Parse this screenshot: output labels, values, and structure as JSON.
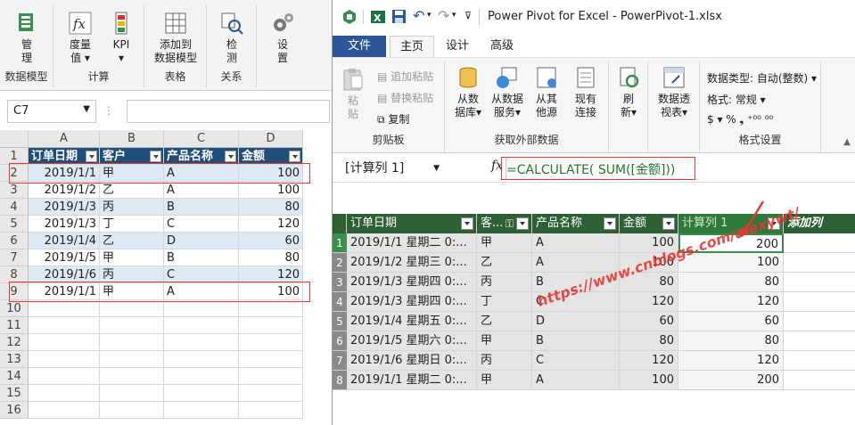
{
  "excel": {
    "ribbon_groups": [
      {
        "buttons": [
          "管",
          "理"
        ],
        "label": "数据模型"
      },
      {
        "buttons": [
          "度量",
          "值",
          "KPI"
        ],
        "label": "计算"
      },
      {
        "buttons": [
          "添加到",
          "数据模型"
        ],
        "label": "表格"
      },
      {
        "buttons": [
          "检",
          "测"
        ],
        "label": "关系"
      },
      {
        "buttons": [
          "设",
          "置"
        ],
        "label": ""
      }
    ],
    "namebox": "C7",
    "fx": "fx",
    "col_letters": [
      "A",
      "B",
      "C",
      "D"
    ],
    "row_numbers": [
      "1",
      "2",
      "3",
      "4",
      "5",
      "6",
      "7",
      "8",
      "9",
      "10",
      "11",
      "12",
      "13",
      "14",
      "15",
      "16"
    ],
    "headers": [
      "订单日期",
      "客户",
      "产品名称",
      "金额"
    ],
    "rows": [
      [
        "2019/1/1",
        "甲",
        "A",
        "100"
      ],
      [
        "2019/1/2",
        "乙",
        "A",
        "100"
      ],
      [
        "2019/1/3",
        "丙",
        "B",
        "80"
      ],
      [
        "2019/1/3",
        "丁",
        "C",
        "120"
      ],
      [
        "2019/1/4",
        "乙",
        "D",
        "60"
      ],
      [
        "2019/1/5",
        "甲",
        "B",
        "80"
      ],
      [
        "2019/1/6",
        "丙",
        "C",
        "120"
      ],
      [
        "2019/1/1",
        "甲",
        "A",
        "100"
      ]
    ]
  },
  "powerpivot": {
    "title": "Power Pivot for Excel - PowerPivot-1.xlsx",
    "tabs": [
      "文件",
      "主页",
      "设计",
      "高级"
    ],
    "clipboard": {
      "paste": "粘",
      "paste2": "贴",
      "append": "追加粘贴",
      "replace": "替换粘贴",
      "copy": "复制",
      "label": "剪贴板"
    },
    "external": {
      "db": [
        "从数",
        "据库"
      ],
      "svc": [
        "从数据",
        "服务"
      ],
      "other": [
        "从其",
        "他源"
      ],
      "existing": [
        "现有",
        "连接"
      ],
      "refresh": [
        "刷",
        "新"
      ],
      "label": "获取外部数据"
    },
    "pivot": [
      "数据透",
      "视表"
    ],
    "format": {
      "dtype": "数据类型: 自动(整数)",
      "fmt": "格式: 常规",
      "symbols": "$ ▾ % ❟ ⁺⁰⁰ ⁰⁰",
      "label": "格式设置"
    },
    "formula": {
      "column_ref": "[计算列 1]",
      "fx": "fx",
      "text": "=CALCULATE( SUM([金额]))"
    },
    "grid_headers": [
      "订单日期",
      "客...",
      "产品名称",
      "金额",
      "计算列 1",
      "添加列"
    ],
    "rows": [
      [
        "2019/1/1 星期二 0:...",
        "甲",
        "A",
        "100",
        "200"
      ],
      [
        "2019/1/2 星期三 0:...",
        "乙",
        "A",
        "100",
        "100"
      ],
      [
        "2019/1/3 星期四 0:...",
        "丙",
        "B",
        "80",
        "80"
      ],
      [
        "2019/1/3 星期四 0:...",
        "丁",
        "C",
        "120",
        "120"
      ],
      [
        "2019/1/4 星期五 0:...",
        "乙",
        "D",
        "60",
        "60"
      ],
      [
        "2019/1/5 星期六 0:...",
        "甲",
        "B",
        "80",
        "80"
      ],
      [
        "2019/1/6 星期日 0:...",
        "丙",
        "C",
        "120",
        "120"
      ],
      [
        "2019/1/1 星期二 0:...",
        "甲",
        "A",
        "100",
        "200"
      ]
    ],
    "watermark": "https://www.cnblogs.com/alexywt/"
  },
  "colors": {
    "excel_header": "#1f4e79",
    "pp_header": "#2f5f34",
    "accent_tab": "#2b579a",
    "red": "#e53935"
  }
}
